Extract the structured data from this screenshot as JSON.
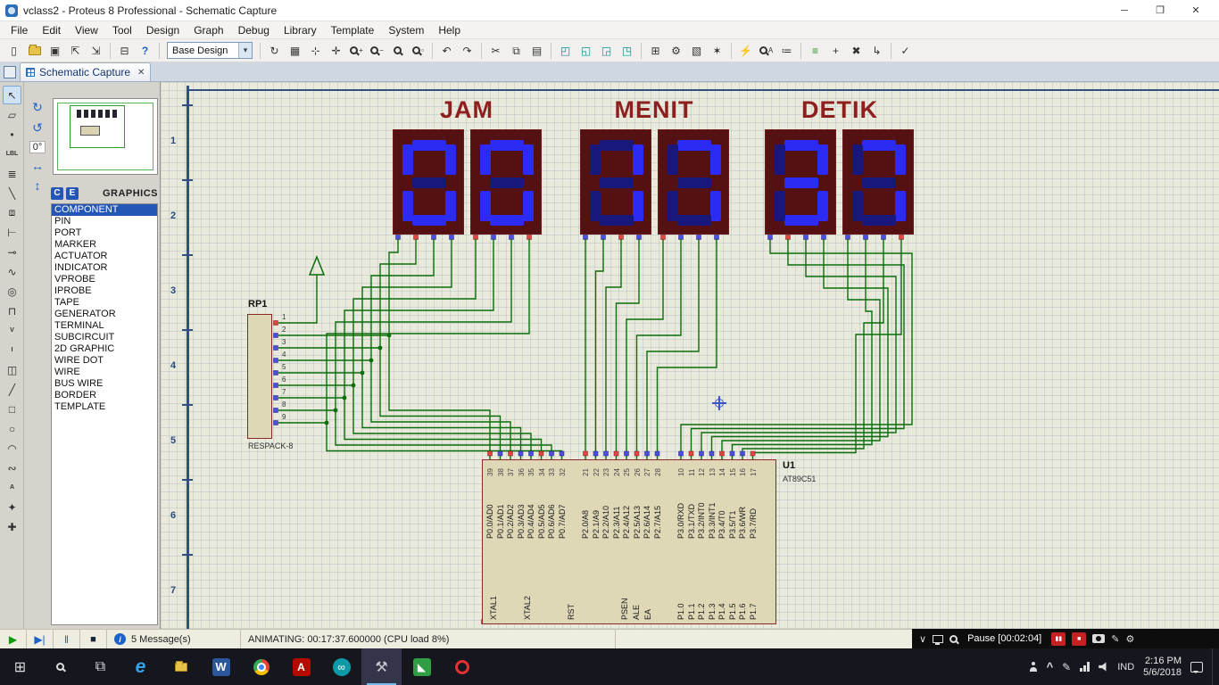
{
  "titlebar": {
    "title": "vclass2 - Proteus 8 Professional - Schematic Capture"
  },
  "menubar": {
    "items": [
      "File",
      "Edit",
      "View",
      "Tool",
      "Design",
      "Graph",
      "Debug",
      "Library",
      "Template",
      "System",
      "Help"
    ]
  },
  "toolbar": {
    "design_dropdown": "Base Design",
    "items": [
      {
        "name": "new-design",
        "glyph": "▯"
      },
      {
        "name": "open-design",
        "glyph": "FOLDER"
      },
      {
        "name": "save-design",
        "glyph": "▣"
      },
      {
        "name": "import-section",
        "glyph": "⇱"
      },
      {
        "name": "export-section",
        "glyph": "⇲"
      },
      {
        "sep": true
      },
      {
        "name": "print-design",
        "glyph": "⊟"
      },
      {
        "name": "help",
        "glyph": "?",
        "cls": "c-blue"
      },
      {
        "sep": true
      },
      {
        "dropdown": true
      },
      {
        "sep": true
      },
      {
        "name": "redraw-display",
        "glyph": "↻"
      },
      {
        "name": "toggle-grid",
        "glyph": "▦"
      },
      {
        "name": "toggle-origin",
        "glyph": "⊹"
      },
      {
        "name": "center-at-cursor",
        "glyph": "✛"
      },
      {
        "name": "zoom-in",
        "glyph": "MAG+"
      },
      {
        "name": "zoom-out",
        "glyph": "MAG−"
      },
      {
        "name": "zoom-all",
        "glyph": "MAG"
      },
      {
        "name": "zoom-area",
        "glyph": "MAG▫"
      },
      {
        "sep": true
      },
      {
        "name": "undo",
        "glyph": "↶"
      },
      {
        "name": "redo",
        "glyph": "↷"
      },
      {
        "sep": true
      },
      {
        "name": "cut",
        "glyph": "✂"
      },
      {
        "name": "copy",
        "glyph": "⧉"
      },
      {
        "name": "paste",
        "glyph": "▤"
      },
      {
        "sep": true
      },
      {
        "name": "block-copy",
        "glyph": "◰",
        "cls": "c-teal"
      },
      {
        "name": "block-move",
        "glyph": "◱",
        "cls": "c-teal"
      },
      {
        "name": "block-rotate",
        "glyph": "◲",
        "cls": "c-teal"
      },
      {
        "name": "block-delete",
        "glyph": "◳",
        "cls": "c-teal"
      },
      {
        "sep": true
      },
      {
        "name": "pick-parts",
        "glyph": "⊞"
      },
      {
        "name": "make-device",
        "glyph": "⚙"
      },
      {
        "name": "packaging-tool",
        "glyph": "▧"
      },
      {
        "name": "decompose",
        "glyph": "✶"
      },
      {
        "sep": true
      },
      {
        "name": "wire-autorouter",
        "glyph": "⚡"
      },
      {
        "name": "search-tag",
        "glyph": "MAGA"
      },
      {
        "name": "property-assignment",
        "glyph": "≔"
      },
      {
        "sep": true
      },
      {
        "name": "design-explorer",
        "glyph": "≡",
        "cls": "c-green"
      },
      {
        "name": "new-sheet",
        "glyph": "+"
      },
      {
        "name": "remove-sheet",
        "glyph": "✖"
      },
      {
        "name": "zoom-to-child",
        "glyph": "↳"
      },
      {
        "sep": true
      },
      {
        "name": "electrical-rules-check",
        "glyph": "✓"
      }
    ]
  },
  "tabbar": {
    "tab_label": "Schematic Capture"
  },
  "mode_toolbar": {
    "items": [
      {
        "name": "selection-mode",
        "glyph": "↖",
        "active": true
      },
      {
        "name": "component-mode",
        "glyph": "▱"
      },
      {
        "name": "junction-dot-mode",
        "glyph": "•"
      },
      {
        "name": "wire-label-mode",
        "glyph": "LBL",
        "small": true
      },
      {
        "name": "text-script-mode",
        "glyph": "≣"
      },
      {
        "name": "buses-mode",
        "glyph": "╲"
      },
      {
        "name": "subcircuit-mode",
        "glyph": "⧈"
      },
      {
        "name": "terminal-mode",
        "glyph": "⊢"
      },
      {
        "name": "device-pin-mode",
        "glyph": "⊸"
      },
      {
        "name": "graph-mode",
        "glyph": "∿"
      },
      {
        "name": "tape-recorder-mode",
        "glyph": "◎"
      },
      {
        "name": "generator-mode",
        "glyph": "⊓"
      },
      {
        "name": "voltage-probe-mode",
        "glyph": "V",
        "small": true
      },
      {
        "name": "current-probe-mode",
        "glyph": "I",
        "small": true
      },
      {
        "name": "virtual-instruments-mode",
        "glyph": "◫"
      },
      {
        "name": "line-mode",
        "glyph": "╱"
      },
      {
        "name": "box-mode",
        "glyph": "□"
      },
      {
        "name": "circle-mode",
        "glyph": "○"
      },
      {
        "name": "arc-mode",
        "glyph": "◠"
      },
      {
        "name": "path-mode",
        "glyph": "∾"
      },
      {
        "name": "text-mode",
        "glyph": "A",
        "small": true
      },
      {
        "name": "symbol-mode",
        "glyph": "✦"
      },
      {
        "name": "marker-mode",
        "glyph": "✚"
      }
    ]
  },
  "sidebar": {
    "rotation_value": "0°",
    "selector_left": "C",
    "selector_right": "E",
    "selector_title": "GRAPHICS",
    "list_selected": "COMPONENT",
    "list_items": [
      "COMPONENT",
      "PIN",
      "PORT",
      "MARKER",
      "ACTUATOR",
      "INDICATOR",
      "VPROBE",
      "IPROBE",
      "TAPE",
      "GENERATOR",
      "TERMINAL",
      "SUBCIRCUIT",
      "2D GRAPHIC",
      "WIRE DOT",
      "WIRE",
      "BUS WIRE",
      "BORDER",
      "TEMPLATE"
    ]
  },
  "schematic": {
    "row_labels": [
      "1",
      "2",
      "3",
      "4",
      "5",
      "6",
      "7"
    ],
    "display_groups": [
      {
        "label": "JAM",
        "digits": [
          "0",
          "0"
        ]
      },
      {
        "label": "MENIT",
        "digits": [
          "1",
          "7"
        ]
      },
      {
        "label": "DETIK",
        "digits": [
          "3",
          "7"
        ]
      }
    ],
    "resistor_pack": {
      "ref": "RP1",
      "value": "RESPACK-8",
      "pins": [
        "1",
        "2",
        "3",
        "4",
        "5",
        "6",
        "7",
        "8",
        "9"
      ]
    },
    "mcu": {
      "ref": "U1",
      "value": "AT89C51",
      "top_pins": [
        {
          "num": "39",
          "name": "P0.0/AD0"
        },
        {
          "num": "38",
          "name": "P0.1/AD1"
        },
        {
          "num": "37",
          "name": "P0.2/AD2"
        },
        {
          "num": "36",
          "name": "P0.3/AD3"
        },
        {
          "num": "35",
          "name": "P0.4/AD4"
        },
        {
          "num": "34",
          "name": "P0.5/AD5"
        },
        {
          "num": "33",
          "name": "P0.6/AD6"
        },
        {
          "num": "32",
          "name": "P0.7/AD7"
        },
        {
          "num": "21",
          "name": "P2.0/A8"
        },
        {
          "num": "22",
          "name": "P2.1/A9"
        },
        {
          "num": "23",
          "name": "P2.2/A10"
        },
        {
          "num": "24",
          "name": "P2.3/A11"
        },
        {
          "num": "25",
          "name": "P2.4/A12"
        },
        {
          "num": "26",
          "name": "P2.5/A13"
        },
        {
          "num": "27",
          "name": "P2.6/A14"
        },
        {
          "num": "28",
          "name": "P2.7/A15"
        },
        {
          "num": "10",
          "name": "P3.0/RXD"
        },
        {
          "num": "11",
          "name": "P3.1/TXD"
        },
        {
          "num": "12",
          "name": "P3.2/INT0"
        },
        {
          "num": "13",
          "name": "P3.3/INT1"
        },
        {
          "num": "14",
          "name": "P3.4/T0"
        },
        {
          "num": "15",
          "name": "P3.5/T1"
        },
        {
          "num": "16",
          "name": "P3.6/WR"
        },
        {
          "num": "17",
          "name": "P3.7/RD"
        }
      ],
      "bottom_pins": [
        "XTAL1",
        "XTAL2",
        "RST",
        "PSEN",
        "ALE",
        "EA",
        "P1.0",
        "P1.1",
        "P1.2",
        "P1.3",
        "P1.4",
        "P1.5",
        "P1.6",
        "P1.7"
      ]
    }
  },
  "statusbar": {
    "controls": [
      {
        "name": "play-button",
        "glyph": "▶",
        "cls": "c-play"
      },
      {
        "name": "step-button",
        "glyph": "▶|",
        "cls": "c-step"
      },
      {
        "name": "pause-button",
        "glyph": "‖",
        "cls": "c-step"
      },
      {
        "name": "stop-button",
        "glyph": "■",
        "cls": "c-stop"
      }
    ],
    "messages_label": "5 Message(s)",
    "status_text": "ANIMATING: 00:17:37.600000 (CPU load 8%)"
  },
  "recorder": {
    "pause_label": "Pause [00:02:04]"
  },
  "taskbar": {
    "apps": [
      {
        "name": "start-button",
        "glyph": "⊞"
      },
      {
        "name": "search-icon",
        "glyph": "MAGW"
      },
      {
        "name": "task-view-button",
        "glyph": "⧉"
      },
      {
        "name": "taskbar-app-edge",
        "glyph": "e",
        "cls": "app-edge"
      },
      {
        "name": "taskbar-app-explorer",
        "glyph": "FOLDER"
      },
      {
        "name": "taskbar-app-word",
        "glyph": "W",
        "cls": "app-word"
      },
      {
        "name": "taskbar-app-chrome",
        "glyph": "CHROME"
      },
      {
        "name": "taskbar-app-acrobat",
        "glyph": "A",
        "cls": "app-acrobat"
      },
      {
        "name": "taskbar-app-teal",
        "glyph": "∞",
        "cls": "app-teal"
      },
      {
        "name": "taskbar-app-proteus",
        "glyph": "⚒",
        "cls": "app-proteus",
        "active": true
      },
      {
        "name": "taskbar-app-green",
        "glyph": "◣",
        "cls": "app-green"
      },
      {
        "name": "taskbar-app-red-ring",
        "glyph": "RING"
      }
    ],
    "language": "IND",
    "time": "2:16 PM",
    "date": "5/6/2018"
  }
}
